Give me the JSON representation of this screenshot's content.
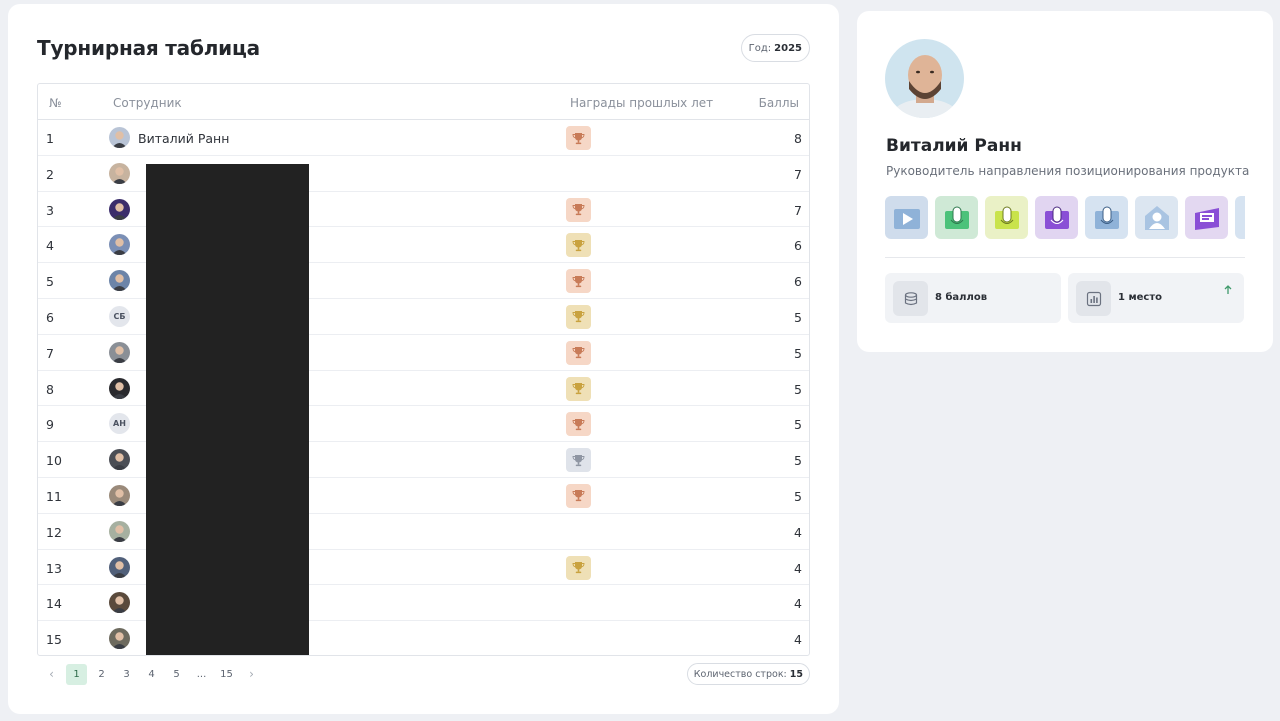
{
  "leaderboard": {
    "title": "Турнирная таблица",
    "year_label": "Год:",
    "year_value": "2025",
    "columns": {
      "num": "№",
      "employee": "Сотрудник",
      "awards": "Награды прошлых лет",
      "points": "Баллы"
    },
    "rows": [
      {
        "num": "1",
        "avatar": "photo",
        "initials": "",
        "name": "Виталий Ранн",
        "award": "bronze",
        "points": "8"
      },
      {
        "num": "2",
        "avatar": "photo",
        "initials": "",
        "name": "",
        "award": "",
        "points": "7"
      },
      {
        "num": "3",
        "avatar": "photo",
        "initials": "",
        "name": "",
        "award": "bronze",
        "points": "7"
      },
      {
        "num": "4",
        "avatar": "photo",
        "initials": "",
        "name": "",
        "award": "gold",
        "points": "6"
      },
      {
        "num": "5",
        "avatar": "photo",
        "initials": "",
        "name": "",
        "award": "bronze",
        "points": "6"
      },
      {
        "num": "6",
        "avatar": "initials",
        "initials": "СБ",
        "name": "",
        "award": "gold",
        "points": "5"
      },
      {
        "num": "7",
        "avatar": "photo",
        "initials": "",
        "name": "",
        "award": "bronze",
        "points": "5"
      },
      {
        "num": "8",
        "avatar": "photo",
        "initials": "",
        "name": "",
        "award": "gold",
        "points": "5"
      },
      {
        "num": "9",
        "avatar": "initials",
        "initials": "АН",
        "name": "",
        "award": "bronze",
        "points": "5"
      },
      {
        "num": "10",
        "avatar": "photo",
        "initials": "",
        "name": "",
        "award": "silver",
        "points": "5"
      },
      {
        "num": "11",
        "avatar": "photo",
        "initials": "",
        "name": "",
        "award": "bronze",
        "points": "5"
      },
      {
        "num": "12",
        "avatar": "photo",
        "initials": "",
        "name": "",
        "award": "",
        "points": "4"
      },
      {
        "num": "13",
        "avatar": "photo",
        "initials": "",
        "name": "",
        "award": "gold",
        "points": "4"
      },
      {
        "num": "14",
        "avatar": "photo",
        "initials": "",
        "name": "",
        "award": "",
        "points": "4"
      },
      {
        "num": "15",
        "avatar": "photo",
        "initials": "",
        "name": "",
        "award": "",
        "points": "4"
      }
    ],
    "pagination": {
      "pages": [
        "1",
        "2",
        "3",
        "4",
        "5",
        "...",
        "15"
      ],
      "current": "1"
    },
    "rows_count_label": "Количество строк:",
    "rows_count_value": "15"
  },
  "profile": {
    "name": "Виталий Ранн",
    "role": "Руководитель направления позиционирования продукта",
    "badges": [
      "play-badge",
      "mic-green-badge",
      "mic-lime-badge",
      "mic-purple-badge",
      "mic-blue-badge",
      "person-badge",
      "monitor-badge",
      "partial-badge"
    ],
    "points_text": "8 баллов",
    "place_text": "1 место"
  },
  "colors": {
    "bronze_bg": "#f6d7c6",
    "gold_bg": "#efe0b6",
    "silver_bg": "#dfe3ea",
    "active_page_bg": "#d7efe2",
    "trend_up": "#3f9a6b"
  }
}
